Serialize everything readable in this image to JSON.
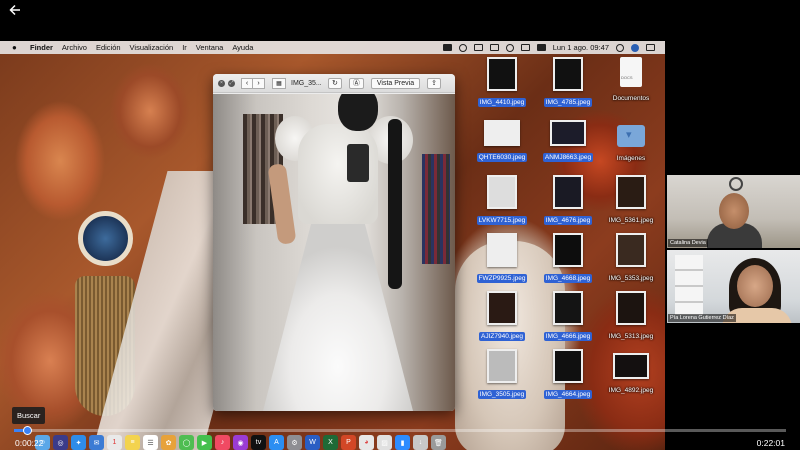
{
  "player": {
    "back_icon": "arrow-left-icon",
    "tooltip": "Buscar",
    "current_time": "0:00:22",
    "total_time": "0:22:01",
    "progress_fraction": 0.0166,
    "accent": "#3b82f6"
  },
  "menubar": {
    "apple_icon": "",
    "items": [
      "Finder",
      "Archivo",
      "Edición",
      "Visualización",
      "Ir",
      "Ventana",
      "Ayuda"
    ],
    "datetime": "Lun 1 ago. 09:47"
  },
  "preview": {
    "title": "IMG_35...",
    "share_label": "Vista Previa"
  },
  "desktop": {
    "selection_color": "#2f62d4",
    "icons_col1": [
      {
        "label": "IMG_4410.jpeg",
        "selected": true
      },
      {
        "label": "QHTE6030.jpeg",
        "selected": true
      },
      {
        "label": "LVKW7715.jpeg",
        "selected": true
      },
      {
        "label": "FWZP9925.jpeg",
        "selected": true
      },
      {
        "label": "AJIZ7940.jpeg",
        "selected": true
      },
      {
        "label": "IMG_3505.jpeg",
        "selected": true
      }
    ],
    "icons_col2": [
      {
        "label": "IMG_4785.jpeg",
        "selected": true
      },
      {
        "label": "ANMJ8663.jpeg",
        "selected": true
      },
      {
        "label": "IMG_4676.jpeg",
        "selected": true
      },
      {
        "label": "IMG_4668.jpeg",
        "selected": true
      },
      {
        "label": "IMG_4666.jpeg",
        "selected": true
      },
      {
        "label": "IMG_4664.jpeg",
        "selected": true
      }
    ],
    "icons_col3": [
      {
        "label": "Documentos",
        "selected": false
      },
      {
        "label": "Imágenes",
        "selected": false
      },
      {
        "label": "IMG_5361.jpeg",
        "selected": false
      },
      {
        "label": "IMG_5353.jpeg",
        "selected": false
      },
      {
        "label": "IMG_5313.jpeg",
        "selected": false
      },
      {
        "label": "IMG_4892.jpeg",
        "selected": false
      }
    ]
  },
  "participants": [
    {
      "name": "Catalina Devia"
    },
    {
      "name": "Pía Lorena Gutierrez Díaz"
    }
  ]
}
